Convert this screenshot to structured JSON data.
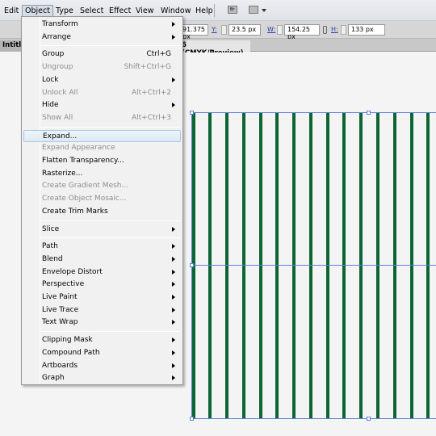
{
  "menubar": {
    "items": [
      "Edit",
      "Object",
      "Type",
      "Select",
      "Effect",
      "View",
      "Window",
      "Help"
    ],
    "active": "Object",
    "bridge_label": "Br"
  },
  "control_bar": {
    "x_value": "91.375 px",
    "y_label": "Y:",
    "y_value": "23.5 px",
    "w_label": "W:",
    "w_value": "154.25 px",
    "h_label": "H:",
    "h_value": "133 px"
  },
  "tabs": [
    {
      "label": "Intitled"
    },
    {
      "label": "6 (CMYK/Preview)"
    }
  ],
  "object_menu": {
    "groups": [
      [
        {
          "label": "Transform",
          "submenu": true
        },
        {
          "label": "Arrange",
          "submenu": true
        }
      ],
      [
        {
          "label": "Group",
          "shortcut": "Ctrl+G"
        },
        {
          "label": "Ungroup",
          "shortcut": "Shift+Ctrl+G",
          "disabled": true
        },
        {
          "label": "Lock",
          "submenu": true
        },
        {
          "label": "Unlock All",
          "shortcut": "Alt+Ctrl+2",
          "disabled": true
        },
        {
          "label": "Hide",
          "submenu": true
        },
        {
          "label": "Show All",
          "shortcut": "Alt+Ctrl+3",
          "disabled": true
        }
      ],
      [
        {
          "label": "Expand...",
          "highlighted": true
        },
        {
          "label": "Expand Appearance",
          "disabled": true
        },
        {
          "label": "Flatten Transparency..."
        },
        {
          "label": "Rasterize..."
        },
        {
          "label": "Create Gradient Mesh...",
          "disabled": true
        },
        {
          "label": "Create Object Mosaic...",
          "disabled": true
        },
        {
          "label": "Create Trim Marks"
        }
      ],
      [
        {
          "label": "Slice",
          "submenu": true
        }
      ],
      [
        {
          "label": "Path",
          "submenu": true
        },
        {
          "label": "Blend",
          "submenu": true
        },
        {
          "label": "Envelope Distort",
          "submenu": true
        },
        {
          "label": "Perspective",
          "submenu": true
        },
        {
          "label": "Live Paint",
          "submenu": true
        },
        {
          "label": "Live Trace",
          "submenu": true
        },
        {
          "label": "Text Wrap",
          "submenu": true
        }
      ],
      [
        {
          "label": "Clipping Mask",
          "submenu": true
        },
        {
          "label": "Compound Path",
          "submenu": true
        },
        {
          "label": "Artboards",
          "submenu": true
        },
        {
          "label": "Graph",
          "submenu": true
        }
      ]
    ]
  },
  "artwork": {
    "stripe_color": "#0c6634",
    "stripe_count": 15,
    "selection_color": "#5b7fd9"
  }
}
